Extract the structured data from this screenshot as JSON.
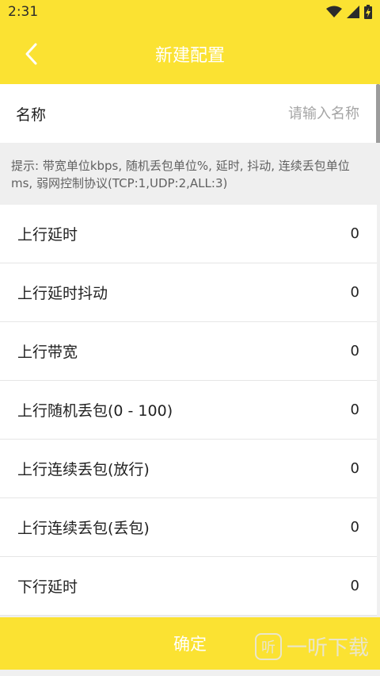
{
  "status_bar": {
    "time": "2:31"
  },
  "toolbar": {
    "back_icon": "chevron-left-icon",
    "title": "新建配置"
  },
  "name_field": {
    "label": "名称",
    "value": "",
    "placeholder": "请输入名称"
  },
  "hint": {
    "text": "提示: 带宽单位kbps, 随机丢包单位%, 延时, 抖动, 连续丢包单位ms, 弱网控制协议(TCP:1,UDP:2,ALL:3)"
  },
  "settings": [
    {
      "label": "上行延时",
      "value": "0"
    },
    {
      "label": "上行延时抖动",
      "value": "0"
    },
    {
      "label": "上行带宽",
      "value": "0"
    },
    {
      "label": "上行随机丢包(0 - 100)",
      "value": "0"
    },
    {
      "label": "上行连续丢包(放行)",
      "value": "0"
    },
    {
      "label": "上行连续丢包(丢包)",
      "value": "0"
    },
    {
      "label": "下行延时",
      "value": "0"
    }
  ],
  "confirm": {
    "label": "确定"
  },
  "watermark": {
    "logo_text": "听",
    "text": "一听下载"
  },
  "colors": {
    "accent": "#fbe232",
    "background": "#f0f0f0"
  }
}
